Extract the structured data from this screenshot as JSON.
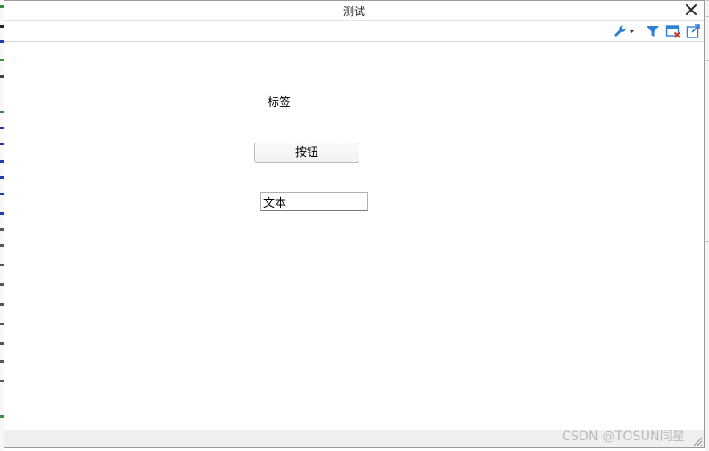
{
  "window": {
    "title": "测试"
  },
  "toolbar": {
    "buttons": [
      {
        "name": "wrench-dropdown",
        "icon": "wrench-icon"
      },
      {
        "name": "filter",
        "icon": "filter-icon"
      },
      {
        "name": "close-panel",
        "icon": "window-close-icon"
      },
      {
        "name": "export",
        "icon": "export-icon"
      }
    ]
  },
  "form": {
    "label": "标签",
    "button_label": "按钮",
    "input_value": "文本"
  },
  "watermark": "CSDN @TOSUN同星",
  "colors": {
    "accent": "#2e7fd6",
    "close_red": "#d9302a",
    "window_border": "#9a9a9a"
  }
}
